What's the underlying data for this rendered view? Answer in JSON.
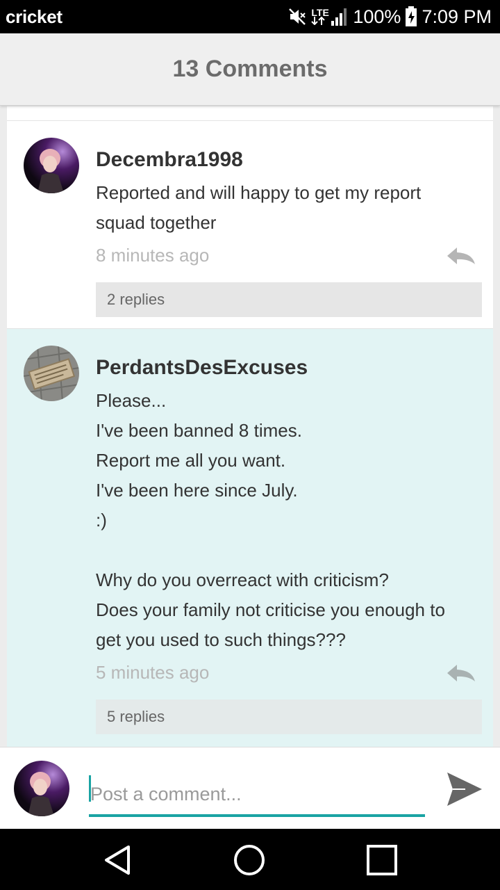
{
  "status_bar": {
    "carrier": "cricket",
    "network": "LTE",
    "battery": "100%",
    "time": "7:09 PM"
  },
  "header": {
    "title": "13 Comments"
  },
  "comments": [
    {
      "username": "Decembra1998",
      "lines": [
        "Reported and will happy to get my report",
        "squad together"
      ],
      "time": "8 minutes ago",
      "replies": "2 replies"
    },
    {
      "username": "PerdantsDesExcuses",
      "lines": [
        "Please...",
        "I've been banned 8 times.",
        "Report me all you want.",
        "I've been here since July.",
        ":)",
        "",
        "Why do you overreact with criticism?",
        "Does your family not criticise you enough to",
        "get you used to such things???"
      ],
      "time": "5 minutes ago",
      "replies": "5 replies"
    }
  ],
  "composer": {
    "placeholder": "Post a comment..."
  },
  "colors": {
    "accent": "#19a3a3",
    "highlight_background": "#e2f4f4"
  }
}
